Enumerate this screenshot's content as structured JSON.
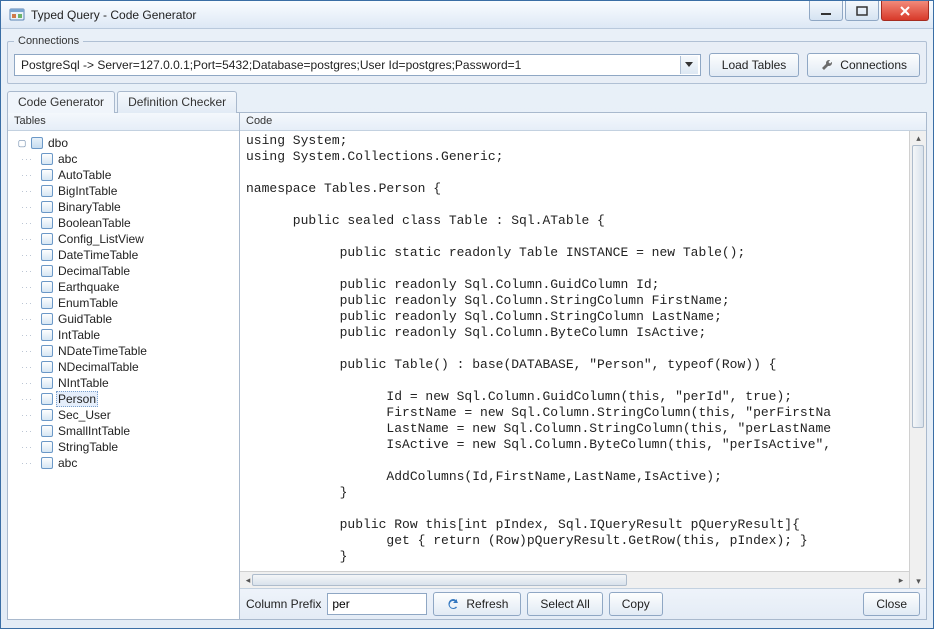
{
  "titlebar": {
    "title": "Typed Query - Code Generator"
  },
  "connections": {
    "legend": "Connections",
    "selected": "PostgreSql -> Server=127.0.0.1;Port=5432;Database=postgres;User Id=postgres;Password=1",
    "load_tables_label": "Load Tables",
    "connections_label": "Connections"
  },
  "tabs": [
    {
      "label": "Code Generator",
      "active": true
    },
    {
      "label": "Definition Checker",
      "active": false
    }
  ],
  "leftpanel": {
    "header": "Tables"
  },
  "tree": {
    "schema": "dbo",
    "tables": [
      "abc",
      "AutoTable",
      "BigIntTable",
      "BinaryTable",
      "BooleanTable",
      "Config_ListView",
      "DateTimeTable",
      "DecimalTable",
      "Earthquake",
      "EnumTable",
      "GuidTable",
      "IntTable",
      "NDateTimeTable",
      "NDecimalTable",
      "NIntTable",
      "Person",
      "Sec_User",
      "SmallIntTable",
      "StringTable",
      "abc"
    ],
    "selected": "Person"
  },
  "code": {
    "header": "Code",
    "text": "using System;\nusing System.Collections.Generic;\n\nnamespace Tables.Person {\n\n      public sealed class Table : Sql.ATable {\n\n            public static readonly Table INSTANCE = new Table();\n\n            public readonly Sql.Column.GuidColumn Id;\n            public readonly Sql.Column.StringColumn FirstName;\n            public readonly Sql.Column.StringColumn LastName;\n            public readonly Sql.Column.ByteColumn IsActive;\n\n            public Table() : base(DATABASE, \"Person\", typeof(Row)) {\n\n                  Id = new Sql.Column.GuidColumn(this, \"perId\", true);\n                  FirstName = new Sql.Column.StringColumn(this, \"perFirstNa\n                  LastName = new Sql.Column.StringColumn(this, \"perLastName\n                  IsActive = new Sql.Column.ByteColumn(this, \"perIsActive\",\n\n                  AddColumns(Id,FirstName,LastName,IsActive);\n            }\n\n            public Row this[int pIndex, Sql.IQueryResult pQueryResult]{\n                  get { return (Row)pQueryResult.GetRow(this, pIndex); }\n            }\n"
  },
  "bottombar": {
    "prefix_label": "Column Prefix",
    "prefix_value": "per",
    "refresh_label": "Refresh",
    "selectall_label": "Select All",
    "copy_label": "Copy",
    "close_label": "Close"
  }
}
